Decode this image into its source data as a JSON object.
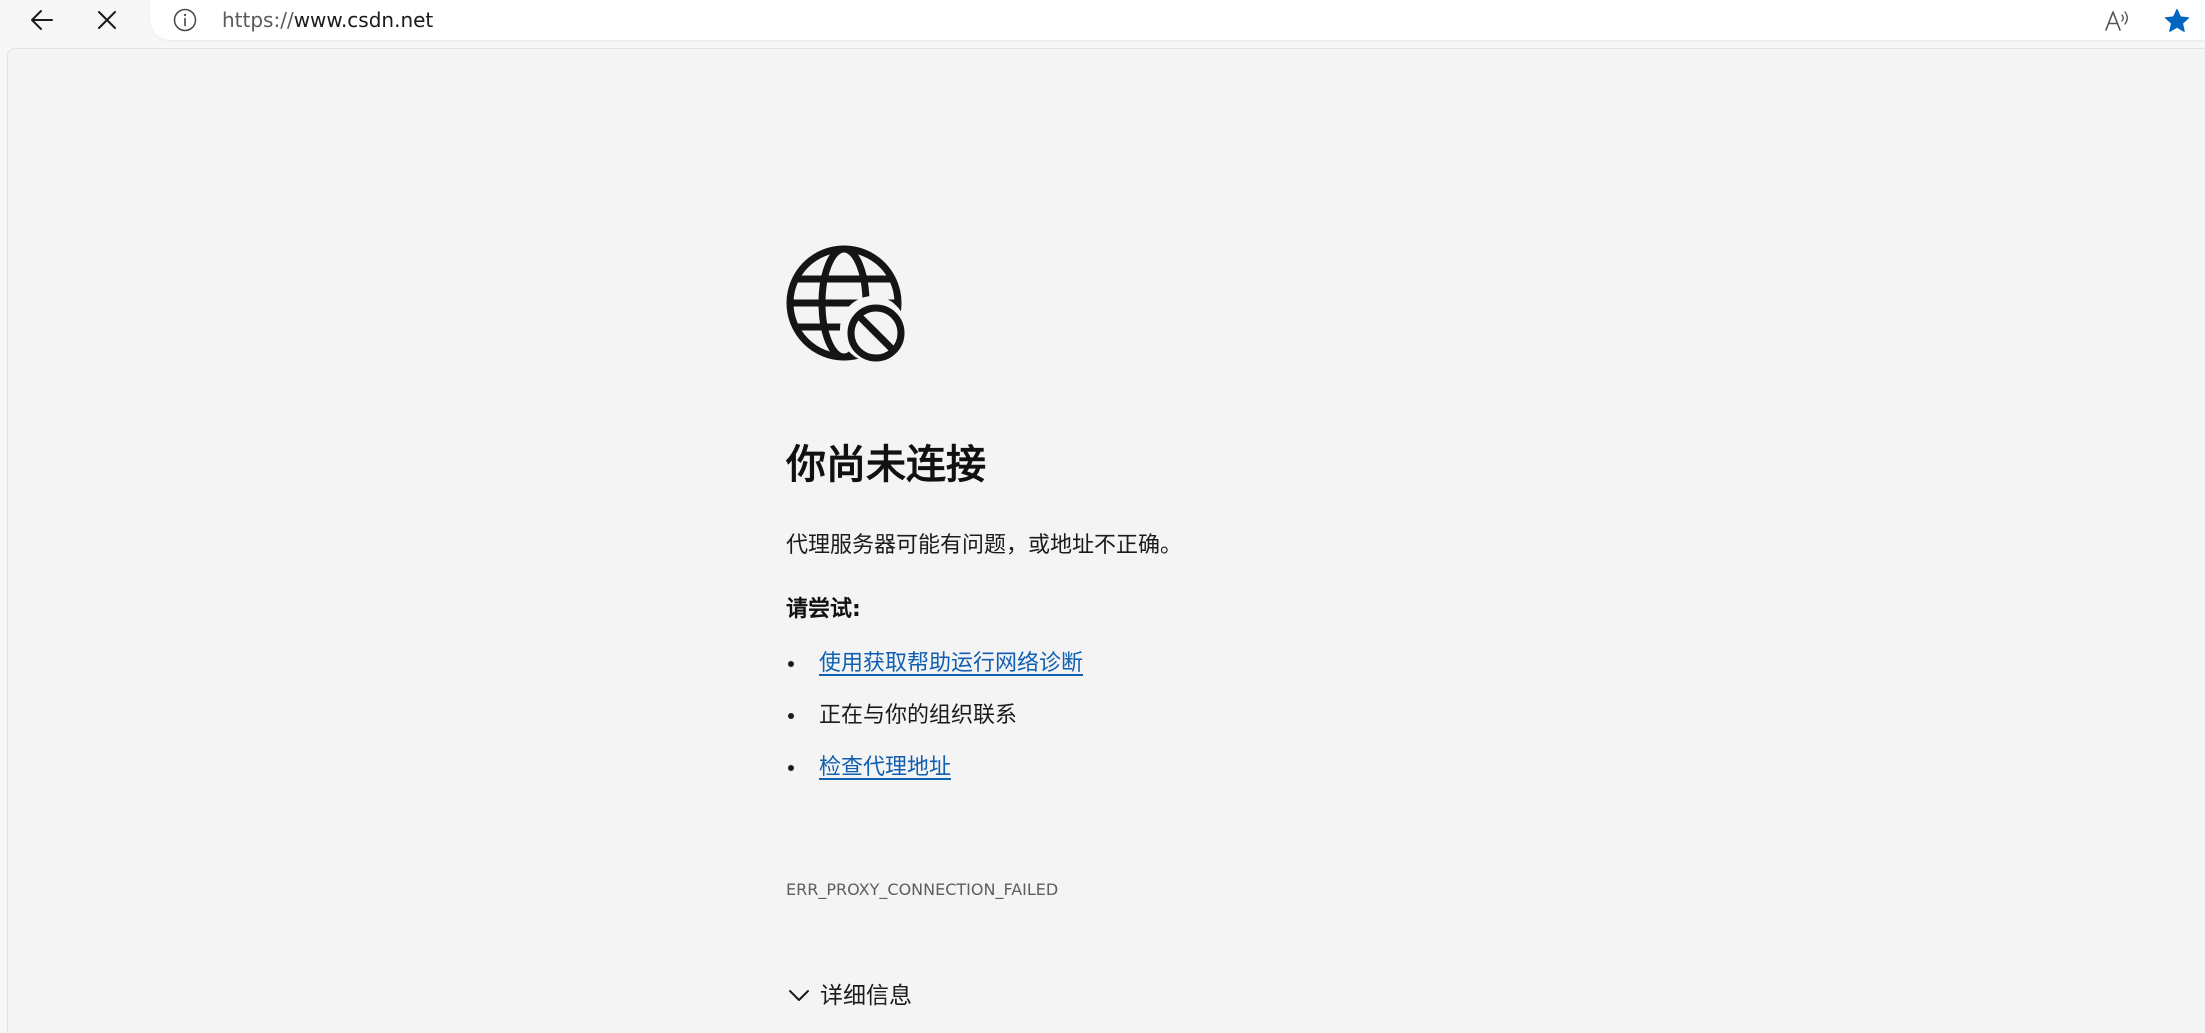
{
  "toolbar": {
    "back_icon": "arrow-left-icon",
    "stop_icon": "close-icon",
    "site_info_icon": "info-circle-icon",
    "url_scheme": "https://",
    "url_host": "www.csdn.net",
    "read_aloud_icon": "read-aloud-icon",
    "favorite_icon": "star-filled-icon",
    "favorite_color": "#0067c0"
  },
  "error_page": {
    "icon": "globe-blocked-icon",
    "title": "你尚未连接",
    "description": "代理服务器可能有问题，或地址不正确。",
    "try_heading": "请尝试:",
    "suggestions": [
      {
        "label": "使用获取帮助运行网络诊断",
        "is_link": true
      },
      {
        "label": "正在与你的组织联系",
        "is_link": false
      },
      {
        "label": "检查代理地址",
        "is_link": true
      }
    ],
    "error_code": "ERR_PROXY_CONNECTION_FAILED",
    "details_label": "详细信息",
    "details_icon": "chevron-down-icon",
    "link_color": "#0f5fb3"
  }
}
